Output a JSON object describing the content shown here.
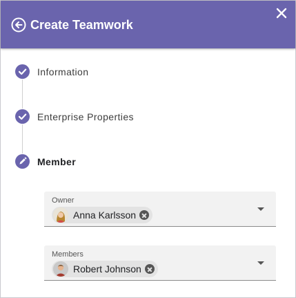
{
  "dialog": {
    "title": "Create Teamwork",
    "header_color": "#6a64ad",
    "back_icon": "arrow-left-circle-icon",
    "close_icon": "close-icon"
  },
  "steps": [
    {
      "label": "Information",
      "status": "completed",
      "icon": "check-circle-icon"
    },
    {
      "label": "Enterprise Properties",
      "status": "completed",
      "icon": "check-circle-icon"
    },
    {
      "label": "Member",
      "status": "active",
      "icon": "edit-pencil-icon"
    }
  ],
  "form": {
    "owner": {
      "label": "Owner",
      "chips": [
        {
          "name": "Anna Karlsson",
          "avatar": "woman-avatar"
        }
      ]
    },
    "members": {
      "label": "Members",
      "chips": [
        {
          "name": "Robert Johnson",
          "avatar": "man-avatar"
        }
      ]
    }
  }
}
